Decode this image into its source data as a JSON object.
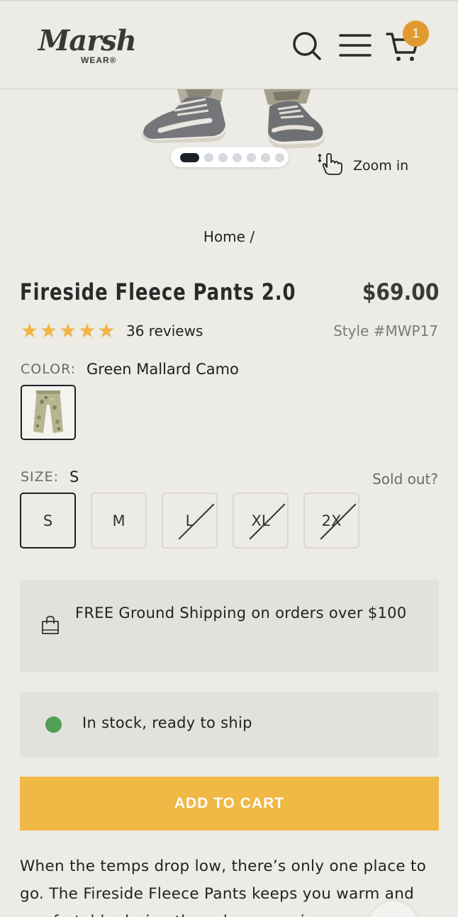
{
  "header": {
    "logo_script": "Marsh",
    "logo_sub": "WEAR®",
    "cart_count": "1",
    "icons": [
      "search-icon",
      "menu-icon",
      "cart-icon"
    ]
  },
  "gallery": {
    "total_slides": 7,
    "active_slide": 1,
    "zoom_label": "Zoom in"
  },
  "breadcrumb": "Home /",
  "product": {
    "title": "Fireside Fleece Pants 2.0",
    "price": "$69.00",
    "rating": 5,
    "reviews": "36 reviews",
    "style": "Style #MWP17",
    "color_label": "COLOR:",
    "color_value": "Green Mallard Camo",
    "size_label": "SIZE:",
    "size_value": "S",
    "sold_out_link": "Sold out?",
    "sizes": [
      {
        "label": "S",
        "available": true,
        "selected": true
      },
      {
        "label": "M",
        "available": true,
        "selected": false
      },
      {
        "label": "L",
        "available": false,
        "selected": false
      },
      {
        "label": "XL",
        "available": false,
        "selected": false
      },
      {
        "label": "2X",
        "available": false,
        "selected": false
      }
    ]
  },
  "shipping": {
    "text": "FREE Ground Shipping on orders over $100"
  },
  "stock": {
    "text": "In stock, ready to ship",
    "status_color": "#4ea055"
  },
  "cta": {
    "label": "ADD TO CART",
    "color": "#f0b844"
  },
  "description": "When the temps drop low, there’s only one place to go. The Fireside Fleece Pants keeps you warm and comfortable during those long eveni"
}
